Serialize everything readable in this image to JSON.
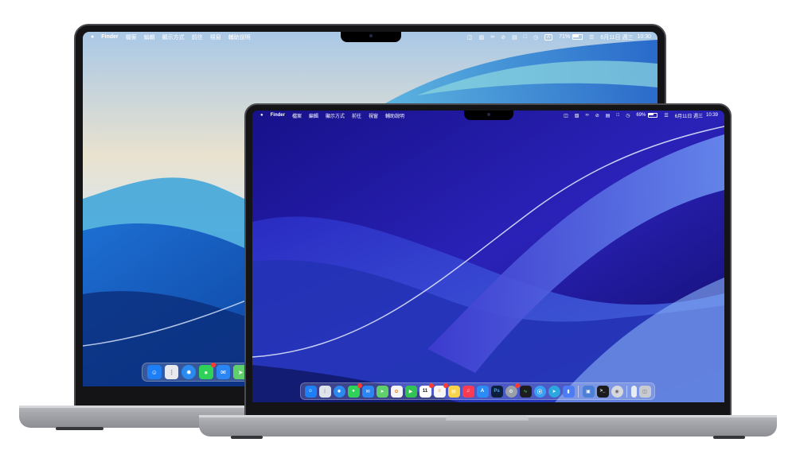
{
  "large_mac": {
    "menubar": {
      "apple_icon": "apple-logo-icon",
      "items": [
        "Finder",
        "檔案",
        "編輯",
        "顯示方式",
        "前往",
        "視窗",
        "輔助說明"
      ],
      "status_icons": [
        "display-icon",
        "screen-share-icon",
        "creative-cloud-icon",
        "sync-icon",
        "clipboard-icon",
        "screenshot-icon",
        "timer-icon",
        "input-source-icon"
      ],
      "input_source": "A",
      "battery": "71%",
      "date": "6月11日 週三",
      "time": "10:30"
    },
    "dock_icons": [
      "finder",
      "launchpad",
      "safari",
      "messages",
      "mail",
      "maps"
    ]
  },
  "small_mac": {
    "menubar": {
      "apple_icon": "apple-logo-icon",
      "items": [
        "Finder",
        "檔案",
        "編輯",
        "顯示方式",
        "前往",
        "視窗",
        "輔助說明"
      ],
      "status_icons": [
        "display-icon",
        "screen-share-icon",
        "creative-cloud-icon",
        "sync-icon",
        "clipboard-icon",
        "screenshot-icon",
        "timer-icon",
        "control-center-icon"
      ],
      "battery": "69%",
      "date": "6月11日 週三",
      "time": "10:39"
    },
    "dock": {
      "calendar_date": "11",
      "photoshop_label": "Ps",
      "apps": [
        {
          "name": "finder",
          "color": "#1e7ef5"
        },
        {
          "name": "launchpad",
          "color": "#dfe3ea"
        },
        {
          "name": "safari",
          "color": "#2a8af0"
        },
        {
          "name": "messages",
          "color": "#2fd158",
          "badge": true
        },
        {
          "name": "mail",
          "color": "#2b86f5"
        },
        {
          "name": "maps",
          "color": "#5fcf6b"
        },
        {
          "name": "photos",
          "color": "#f4f4f4"
        },
        {
          "name": "facetime",
          "color": "#31c452"
        },
        {
          "name": "calendar",
          "color": "#ffffff",
          "badge": true
        },
        {
          "name": "reminders",
          "color": "#f7f7f7",
          "badge": true
        },
        {
          "name": "notes",
          "color": "#f7d24a"
        },
        {
          "name": "music",
          "color": "#fa3b52"
        },
        {
          "name": "app-store",
          "color": "#2a8cf4"
        },
        {
          "name": "photoshop",
          "color": "#0c1f3d"
        },
        {
          "name": "system-settings",
          "color": "#9aa0a8",
          "badge": true
        },
        {
          "name": "activity-monitor",
          "color": "#1d1d1f"
        },
        {
          "name": "airdrop",
          "color": "#38a0f5"
        },
        {
          "name": "telegram",
          "color": "#2ba6de"
        },
        {
          "name": "zoom",
          "color": "#4b7cf3"
        }
      ],
      "recent": [
        {
          "name": "preview",
          "color": "#4c7fd6"
        },
        {
          "name": "terminal",
          "color": "#1b1b1d"
        },
        {
          "name": "system-info",
          "color": "#d5d8dc"
        }
      ],
      "tail": [
        {
          "name": "downloads-stack",
          "color": "#e9ecf0"
        },
        {
          "name": "trash",
          "color": "#c8cbd0"
        }
      ]
    }
  }
}
